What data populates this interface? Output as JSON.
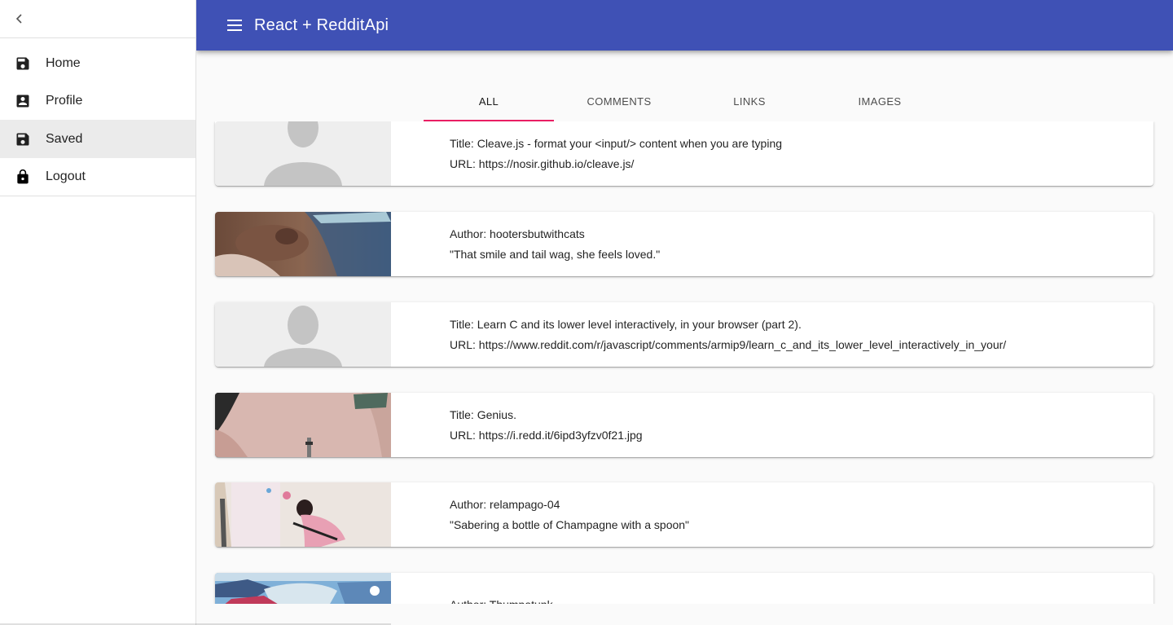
{
  "appbar": {
    "title": "React + RedditApi"
  },
  "drawer": {
    "items": [
      {
        "label": "Home",
        "icon": "save-icon"
      },
      {
        "label": "Profile",
        "icon": "account-box-icon"
      },
      {
        "label": "Saved",
        "icon": "save-icon",
        "selected": true
      },
      {
        "label": "Logout",
        "icon": "lock-icon"
      }
    ]
  },
  "tabs": [
    {
      "label": "ALL",
      "active": true
    },
    {
      "label": "COMMENTS"
    },
    {
      "label": "LINKS"
    },
    {
      "label": "IMAGES"
    }
  ],
  "posts": [
    {
      "line1": "Title: Cleave.js - format your <input/> content when you are typing",
      "line2": "URL: https://nosir.github.io/cleave.js/",
      "thumb": "placeholder-avatar"
    },
    {
      "line1": "Author: hootersbutwithcats",
      "line2": "\"That smile and tail wag, she feels loved.\"",
      "thumb": "dog-photo"
    },
    {
      "line1": "Title: Learn C and its lower level interactively, in your browser (part 2).",
      "line2": "URL: https://www.reddit.com/r/javascript/comments/armip9/learn_c_and_its_lower_level_interactively_in_your/",
      "thumb": "placeholder-avatar"
    },
    {
      "line1": "Title: Genius.",
      "line2": "URL: https://i.redd.it/6ipd3yfzv0f21.jpg",
      "thumb": "hand-photo"
    },
    {
      "line1": "Author: relampago-04",
      "line2": "\"Sabering a bottle of Champagne with a spoon\"",
      "thumb": "person-photo"
    },
    {
      "line1": "Author: Thumpatunk",
      "line2": "",
      "thumb": "boat-photo"
    }
  ],
  "colors": {
    "appbar": "#3f51b5",
    "tab_indicator": "#e91e63"
  }
}
